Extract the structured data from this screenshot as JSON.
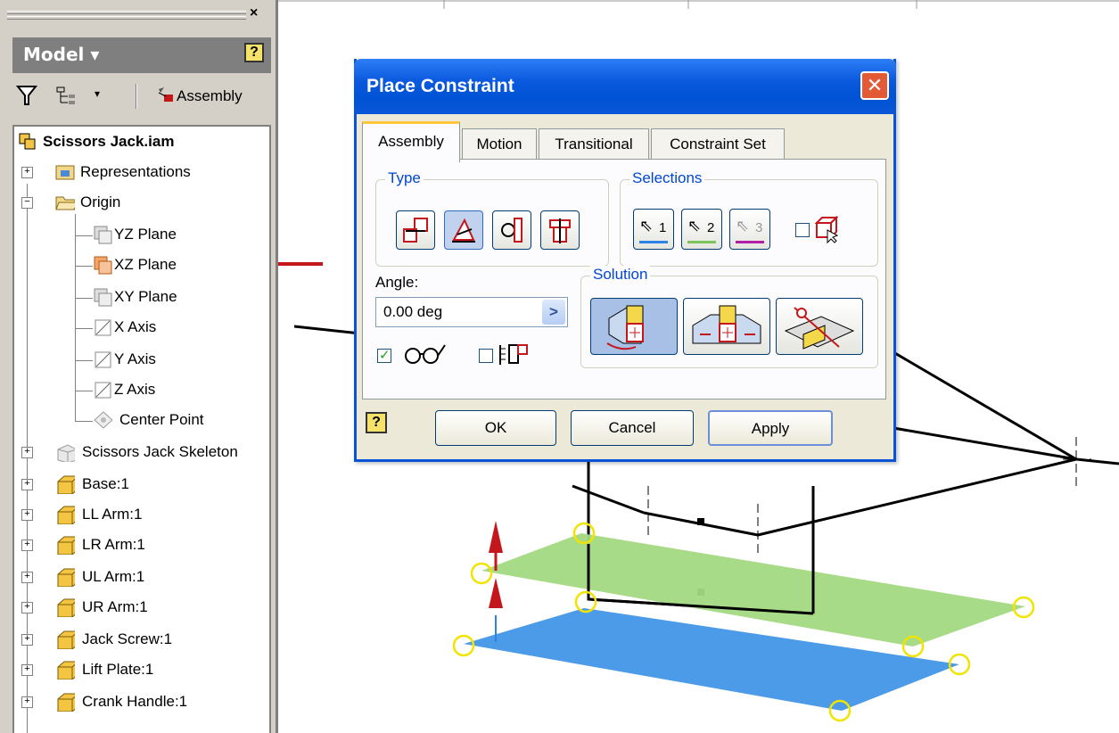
{
  "browser": {
    "close_glyph": "×",
    "model_label": "Model ▾",
    "help_glyph": "?",
    "dropdown_glyph": "▾",
    "assembly_label": "Assembly",
    "root": "Scissors Jack.iam",
    "items": {
      "representations": "Representations",
      "origin": "Origin",
      "yz_plane": "YZ Plane",
      "xz_plane": "XZ Plane",
      "xy_plane": "XY Plane",
      "x_axis": "X Axis",
      "y_axis": "Y Axis",
      "z_axis": "Z Axis",
      "center_point": "Center Point",
      "skeleton": "Scissors Jack Skeleton",
      "base": "Base:1",
      "ll_arm": "LL Arm:1",
      "lr_arm": "LR Arm:1",
      "ul_arm": "UL Arm:1",
      "ur_arm": "UR Arm:1",
      "jack_screw": "Jack Screw:1",
      "lift_plate": "Lift Plate:1",
      "crank_handle": "Crank Handle:1"
    }
  },
  "dialog": {
    "title": "Place Constraint",
    "close_glyph": "✕",
    "tabs": {
      "assembly": "Assembly",
      "motion": "Motion",
      "transitional": "Transitional",
      "constraint_set": "Constraint Set"
    },
    "type_label": "Type",
    "selections_label": "Selections",
    "sel1": "1",
    "sel2": "2",
    "sel3": "3",
    "angle_label": "Angle:",
    "angle_value": "0.00 deg",
    "angle_arrow": ">",
    "solution_label": "Solution",
    "preview_checked": true,
    "ok": "OK",
    "cancel": "Cancel",
    "apply": "Apply",
    "help_glyph": "?"
  },
  "colors": {
    "title_blue": "#0053d4",
    "group_label": "#0046d5",
    "plane_green": "#a3d982",
    "plane_blue": "#4c9be8",
    "arrow_red": "#c4171b",
    "selection1": "#2d82e6",
    "selection2": "#7cc45b",
    "selection3": "#b21fa6"
  }
}
